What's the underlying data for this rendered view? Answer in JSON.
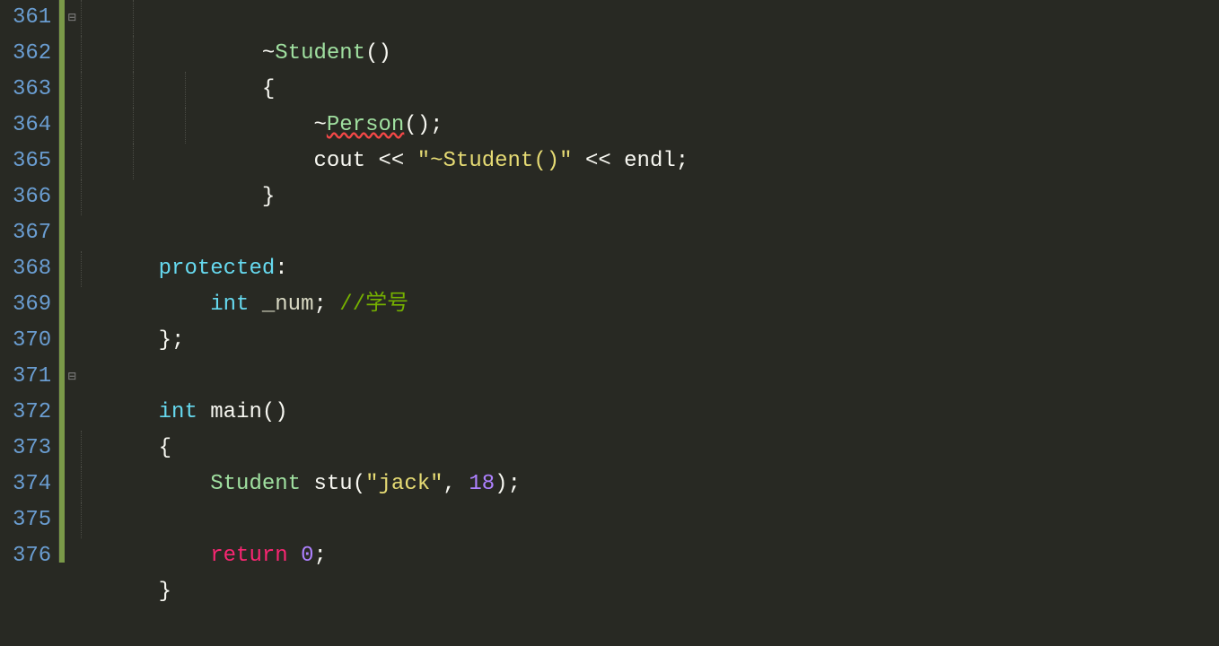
{
  "gutter": {
    "lines": [
      "361",
      "362",
      "363",
      "364",
      "365",
      "366",
      "367",
      "368",
      "369",
      "370",
      "371",
      "372",
      "373",
      "374",
      "375",
      "376"
    ]
  },
  "fold": {
    "markers": {
      "0": "⊟",
      "10": "⊟"
    }
  },
  "code": {
    "l0": {
      "indent": "        ",
      "dtor": "~",
      "cls": "Student",
      "paren": "()"
    },
    "l1": {
      "indent": "        ",
      "brace": "{"
    },
    "l2": {
      "indent": "            ",
      "dtor": "~",
      "cls": "Person",
      "paren": "()",
      "semi": ";"
    },
    "l3": {
      "indent": "            ",
      "cout": "cout",
      "sp1": " ",
      "op1": "<<",
      "sp2": " ",
      "str": "\"~Student()\"",
      "sp3": " ",
      "op2": "<<",
      "sp4": " ",
      "endl": "endl",
      "semi": ";"
    },
    "l4": {
      "indent": "        ",
      "brace": "}"
    },
    "l5": {
      "blank": ""
    },
    "l6": {
      "kw": "protected",
      "colon": ":"
    },
    "l7": {
      "indent": "    ",
      "type": "int",
      "sp1": " ",
      "ident": "_num",
      "semi": "; ",
      "comment": "//学号"
    },
    "l8": {
      "brace": "}",
      "semi": ";"
    },
    "l9": {
      "blank": ""
    },
    "l10": {
      "type": "int",
      "sp": " ",
      "fn": "main",
      "paren": "()"
    },
    "l11": {
      "brace": "{"
    },
    "l12": {
      "indent": "    ",
      "cls": "Student",
      "sp1": " ",
      "var": "stu",
      "open": "(",
      "str": "\"jack\"",
      "comma": ", ",
      "num": "18",
      "close": ")",
      "semi": ";"
    },
    "l13": {
      "blank": ""
    },
    "l14": {
      "indent": "    ",
      "kw": "return",
      "sp": " ",
      "num": "0",
      "semi": ";"
    },
    "l15": {
      "brace": "}"
    }
  }
}
